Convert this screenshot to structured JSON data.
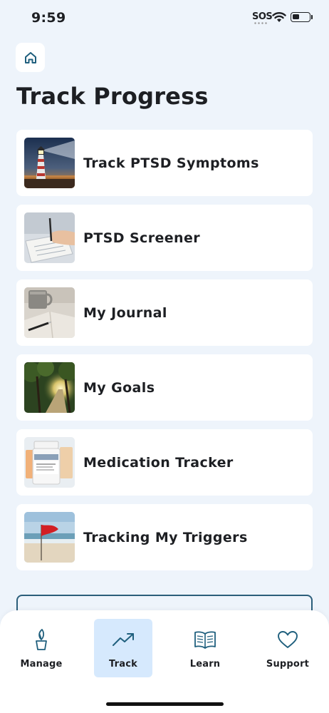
{
  "status_bar": {
    "time": "9:59",
    "sos": "SOS",
    "icons": [
      "wifi-icon",
      "battery-icon"
    ]
  },
  "header": {
    "home_icon": "home-icon",
    "title": "Track Progress"
  },
  "cards": [
    {
      "label": "Track PTSD Symptoms",
      "thumbnail": "lighthouse-image"
    },
    {
      "label": "PTSD Screener",
      "thumbnail": "writing-hand-image"
    },
    {
      "label": "My Journal",
      "thumbnail": "journal-mug-image"
    },
    {
      "label": "My Goals",
      "thumbnail": "forest-path-image"
    },
    {
      "label": "Medication Tracker",
      "thumbnail": "pill-bottles-image"
    },
    {
      "label": "Tracking My Triggers",
      "thumbnail": "red-flag-beach-image"
    }
  ],
  "bottom_nav": {
    "items": [
      {
        "label": "Manage",
        "icon": "plant-icon",
        "active": false
      },
      {
        "label": "Track",
        "icon": "trending-up-icon",
        "active": true
      },
      {
        "label": "Learn",
        "icon": "book-icon",
        "active": false
      },
      {
        "label": "Support",
        "icon": "heart-icon",
        "active": false
      }
    ]
  },
  "colors": {
    "background": "#eef4fb",
    "card": "#ffffff",
    "accent": "#1f5f7d",
    "active_tab": "#d6e9fd",
    "text": "#1d1f23"
  }
}
